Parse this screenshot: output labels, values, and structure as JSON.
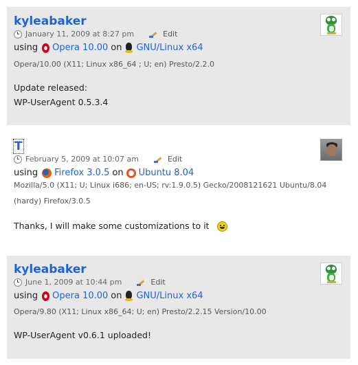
{
  "comments": [
    {
      "author": "kyleabaker",
      "date": "January 11, 2009 at 8:27 pm",
      "edit_label": "Edit",
      "using_label": "using",
      "browser": "Opera 10.00",
      "on_label": "on",
      "os": "GNU/Linux x64",
      "user_agent": "Opera/10.00 (X11; Linux x86_64 ; U; en) Presto/2.2.0",
      "body_lines": [
        "Update released:",
        "WP-UserAgent 0.5.3.4"
      ],
      "browser_icon": "opera-icon",
      "os_icon": "tux-icon",
      "avatar": "frog-avatar"
    },
    {
      "author": "T",
      "date": "February 5, 2009 at 10:07 am",
      "edit_label": "Edit",
      "using_label": "using",
      "browser": "Firefox 3.0.5",
      "on_label": "on",
      "os": "Ubuntu 8.04",
      "user_agent": "Mozilla/5.0 (X11; U; Linux i686; en-US; rv:1.9.0.5) Gecko/2008121621 Ubuntu/8.04 (hardy) Firefox/3.0.5",
      "body_lines": [
        "Thanks, I will make some customizations to it"
      ],
      "browser_icon": "firefox-icon",
      "os_icon": "ubuntu-icon",
      "avatar": "photo-avatar",
      "emoticon": "smiley-icon"
    },
    {
      "author": "kyleabaker",
      "date": "June 1, 2009 at 10:44 pm",
      "edit_label": "Edit",
      "using_label": "using",
      "browser": "Opera 10.00",
      "on_label": "on",
      "os": "GNU/Linux x64",
      "user_agent": "Opera/9.80 (X11; Linux x86_64; U; en) Presto/2.2.15 Version/10.00",
      "body_lines": [
        "WP-UserAgent v0.6.1 uploaded!"
      ],
      "browser_icon": "opera-icon",
      "os_icon": "tux-icon",
      "avatar": "frog-avatar"
    }
  ],
  "colors": {
    "link": "#1e63d6",
    "alt_background": "#e8e8e8",
    "meta_text": "#666666"
  }
}
